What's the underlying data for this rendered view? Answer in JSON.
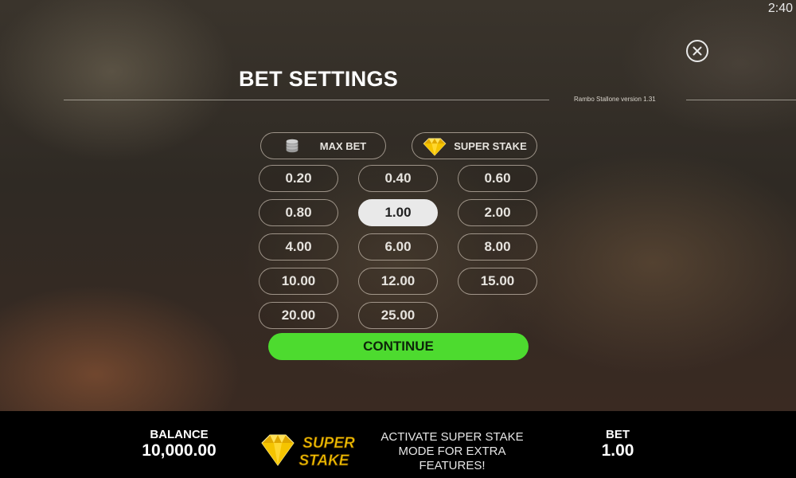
{
  "status": {
    "clock": "2:40"
  },
  "dialog": {
    "title": "BET SETTINGS",
    "version": "Rambo Stallone version 1.31",
    "max_bet_label": "MAX BET",
    "super_stake_label": "SUPER STAKE",
    "bet_options": [
      "0.20",
      "0.40",
      "0.60",
      "0.80",
      "1.00",
      "2.00",
      "4.00",
      "6.00",
      "8.00",
      "10.00",
      "12.00",
      "15.00",
      "20.00",
      "25.00"
    ],
    "selected_bet": "1.00",
    "continue_label": "CONTINUE"
  },
  "bottom_bar": {
    "balance_label": "BALANCE",
    "balance_value": "10,000.00",
    "logo_text_top": "SUPER",
    "logo_text_bottom": "STAKE",
    "promo_text": "ACTIVATE SUPER STAKE MODE FOR EXTRA FEATURES!",
    "bet_label": "BET",
    "bet_value": "1.00"
  },
  "colors": {
    "continue_green": "#4ddb2f",
    "selected_bet_bg": "#e9e9e9",
    "gem_yellow": "#f5c400"
  },
  "icons": {
    "close": "close-icon",
    "max_bet": "coin-stack-icon",
    "super_stake": "diamond-gem-icon"
  }
}
